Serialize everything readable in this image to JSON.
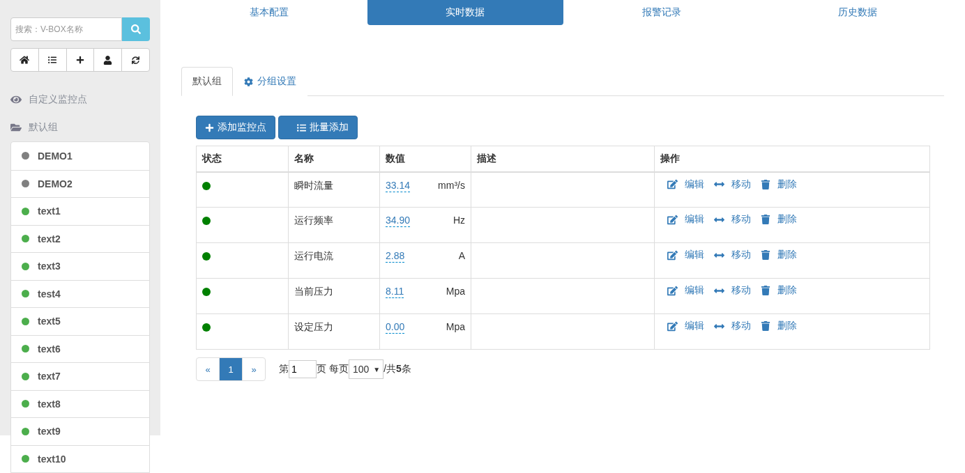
{
  "sidebar": {
    "search": {
      "placeholder": "搜索：V-BOX名称"
    },
    "groups": [
      {
        "kind": "eye",
        "label": "自定义监控点"
      },
      {
        "kind": "folder",
        "label": "默认组"
      }
    ],
    "devices": [
      {
        "name": "DEMO1",
        "color": "#808080"
      },
      {
        "name": "DEMO2",
        "color": "#808080"
      },
      {
        "name": "text1",
        "color": "#4cae4c"
      },
      {
        "name": "text2",
        "color": "#4cae4c"
      },
      {
        "name": "text3",
        "color": "#4cae4c"
      },
      {
        "name": "test4",
        "color": "#4cae4c"
      },
      {
        "name": "text5",
        "color": "#4cae4c"
      },
      {
        "name": "text6",
        "color": "#4cae4c"
      },
      {
        "name": "text7",
        "color": "#4cae4c"
      },
      {
        "name": "text8",
        "color": "#4cae4c"
      },
      {
        "name": "text9",
        "color": "#4cae4c"
      },
      {
        "name": "text10",
        "color": "#4cae4c"
      }
    ]
  },
  "nav_tabs": [
    {
      "label": "基本配置",
      "selected": false
    },
    {
      "label": "实时数据",
      "selected": true
    },
    {
      "label": "报警记录",
      "selected": false
    },
    {
      "label": "历史数据",
      "selected": false
    }
  ],
  "group_tabs": [
    {
      "label": "默认组",
      "selected": true,
      "kind": "plain"
    },
    {
      "label": "分组设置",
      "selected": false,
      "kind": "gear"
    }
  ],
  "buttons": [
    {
      "kind": "plus",
      "label": "添加监控点"
    },
    {
      "kind": "list",
      "label": "批量添加"
    }
  ],
  "table": {
    "columns": [
      "状态",
      "名称",
      "数值",
      "描述",
      "操作"
    ],
    "rows": [
      {
        "color": "#008000",
        "name": "瞬时流量",
        "value": "33.14",
        "unit": "mm³/s",
        "actions": [
          "编辑",
          "移动",
          "删除"
        ]
      },
      {
        "color": "#008000",
        "name": "运行频率",
        "value": "34.90",
        "unit": "Hz",
        "actions": [
          "编辑",
          "移动",
          "删除"
        ]
      },
      {
        "color": "#008000",
        "name": "运行电流",
        "value": "2.88",
        "unit": "A",
        "actions": [
          "编辑",
          "移动",
          "删除"
        ]
      },
      {
        "color": "#008000",
        "name": "当前压力",
        "value": "8.11",
        "unit": "Mpa",
        "actions": [
          "编辑",
          "移动",
          "删除"
        ]
      },
      {
        "color": "#008000",
        "name": "设定压力",
        "value": "0.00",
        "unit": "Mpa",
        "actions": [
          "编辑",
          "移动",
          "删除"
        ]
      }
    ]
  },
  "pagination": {
    "prev": "«",
    "pages": [
      {
        "label": "1",
        "selected": true
      }
    ],
    "next": "»",
    "page_prefix": "第",
    "page_value": "1",
    "page_suffix": "页 每页",
    "per_page": "100",
    "caret": "▼",
    "total": "/共**5**条"
  }
}
